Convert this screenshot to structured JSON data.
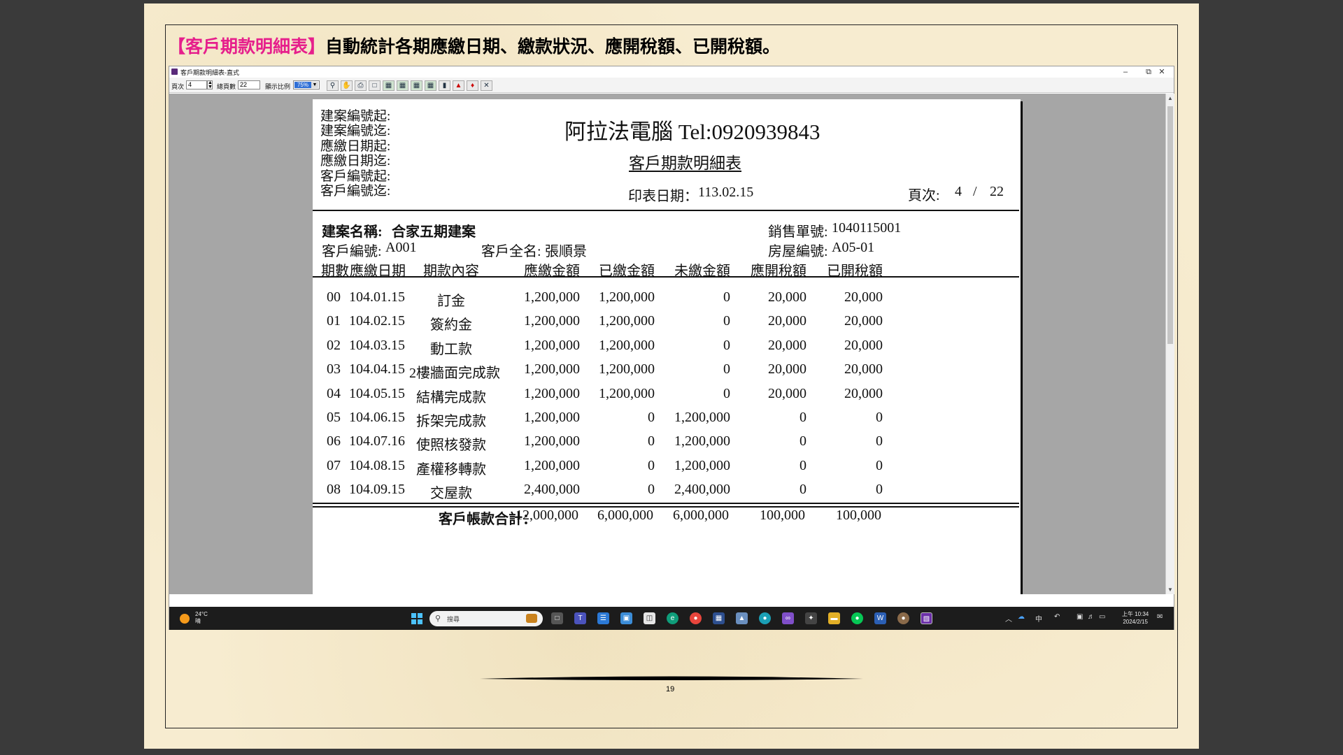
{
  "slide": {
    "heading_highlight": "【客戶期款明細表】",
    "heading_rest": "自動統計各期應繳日期、繳款狀況、應開稅額、已開稅額。",
    "page_number": "19"
  },
  "window": {
    "title": "客戶期款明細表-直式",
    "minimize": "–",
    "restore": "⧉",
    "close": "✕"
  },
  "toolbar": {
    "page_label": "頁次",
    "page_value": "4",
    "total_label": "總頁數",
    "total_value": "22",
    "zoom_label": "顯示比例",
    "zoom_value": "75%",
    "tools": [
      "search-icon",
      "hand-icon",
      "print-icon",
      "page-icon",
      "excel-icon",
      "export-icon",
      "export2-icon",
      "export3-icon",
      "book-icon",
      "pdf-icon",
      "word-icon",
      "close-box-icon"
    ]
  },
  "report": {
    "criteria": [
      "建案編號起:",
      "建案編號迄:",
      "應繳日期起:",
      "應繳日期迄:",
      "客戶編號起:",
      "客戶編號迄:"
    ],
    "company": "阿拉法電腦 Tel:0920939843",
    "title": "客戶期款明細表",
    "print_date_label": "印表日期：",
    "print_date": "113.02.15",
    "page_label": "頁次:",
    "page_current": "4",
    "page_sep": "/",
    "page_total": "22",
    "project_label": "建案名稱:",
    "project_name": "合家五期建案",
    "sales_no_label": "銷售單號:",
    "sales_no": "1040115001",
    "customer_no_label": "客戶編號:",
    "customer_no": "A001",
    "customer_name_label": "客戶全名:",
    "customer_name": "張順景",
    "house_no_label": "房屋編號:",
    "house_no": "A05-01",
    "columns": [
      "期數",
      "應繳日期",
      "期款內容",
      "應繳金額",
      "已繳金額",
      "未繳金額",
      "應開稅額",
      "已開稅額"
    ],
    "rows": [
      [
        "00",
        "104.01.15",
        "訂金",
        "1,200,000",
        "1,200,000",
        "0",
        "20,000",
        "20,000"
      ],
      [
        "01",
        "104.02.15",
        "簽約金",
        "1,200,000",
        "1,200,000",
        "0",
        "20,000",
        "20,000"
      ],
      [
        "02",
        "104.03.15",
        "動工款",
        "1,200,000",
        "1,200,000",
        "0",
        "20,000",
        "20,000"
      ],
      [
        "03",
        "104.04.15",
        "2樓牆面完成款",
        "1,200,000",
        "1,200,000",
        "0",
        "20,000",
        "20,000"
      ],
      [
        "04",
        "104.05.15",
        "結構完成款",
        "1,200,000",
        "1,200,000",
        "0",
        "20,000",
        "20,000"
      ],
      [
        "05",
        "104.06.15",
        "拆架完成款",
        "1,200,000",
        "0",
        "1,200,000",
        "0",
        "0"
      ],
      [
        "06",
        "104.07.16",
        "使照核發款",
        "1,200,000",
        "0",
        "1,200,000",
        "0",
        "0"
      ],
      [
        "07",
        "104.08.15",
        "產權移轉款",
        "1,200,000",
        "0",
        "1,200,000",
        "0",
        "0"
      ],
      [
        "08",
        "104.09.15",
        "交屋款",
        "2,400,000",
        "0",
        "2,400,000",
        "0",
        "0"
      ]
    ],
    "total_label": "客戶帳款合計：",
    "totals": [
      "12,000,000",
      "6,000,000",
      "6,000,000",
      "100,000",
      "100,000"
    ]
  },
  "taskbar": {
    "weather_temp": "24°C",
    "weather_desc": "晴",
    "search_placeholder": "搜尋",
    "ime": "中",
    "time": "上午 10:34",
    "date": "2024/2/15"
  }
}
